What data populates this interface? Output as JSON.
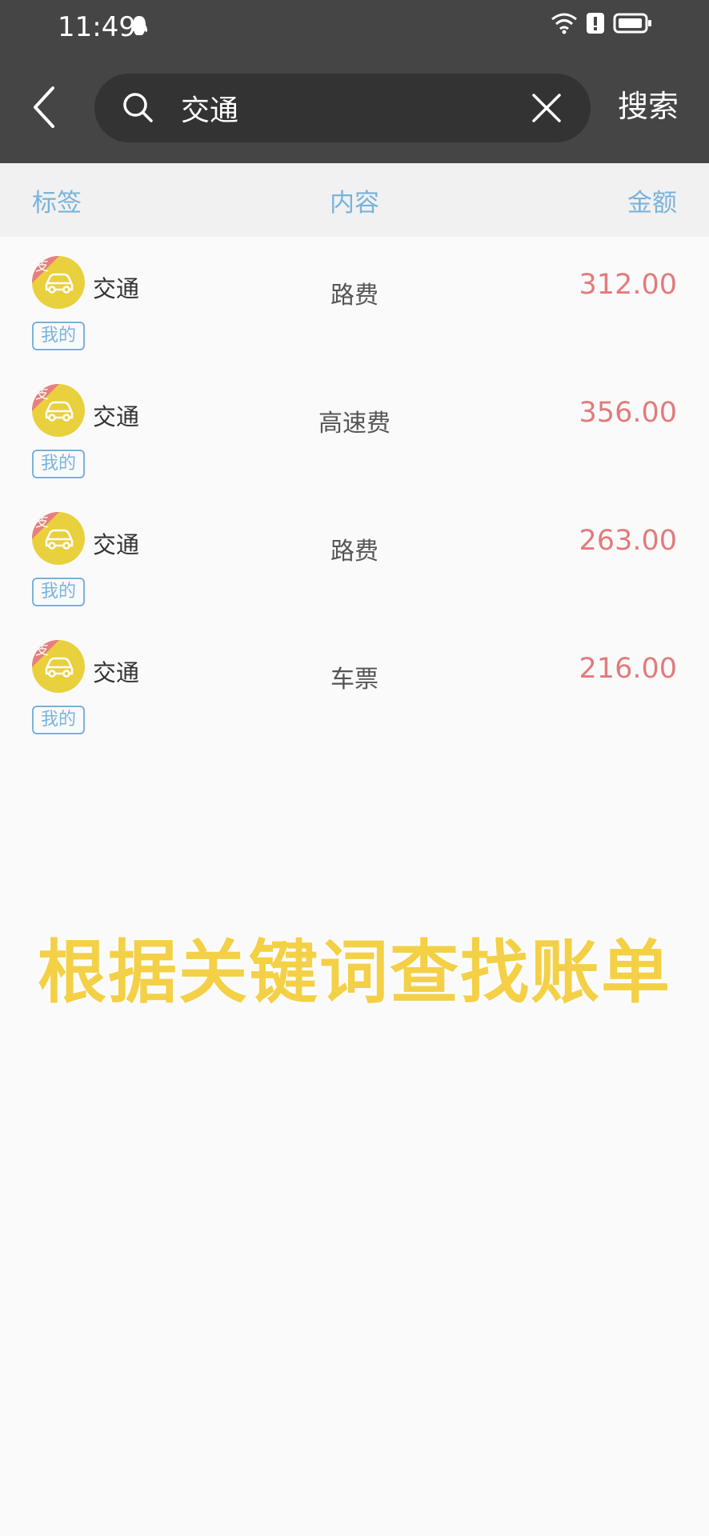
{
  "status_bar": {
    "time": "11:49"
  },
  "search": {
    "query": "交通",
    "button_label": "搜索"
  },
  "columns": {
    "tag": "标签",
    "content": "内容",
    "amount": "金额"
  },
  "records": [
    {
      "badge": "支",
      "category": "交通",
      "owner": "我的",
      "description": "路费",
      "amount": "312.00"
    },
    {
      "badge": "支",
      "category": "交通",
      "owner": "我的",
      "description": "高速费",
      "amount": "356.00"
    },
    {
      "badge": "支",
      "category": "交通",
      "owner": "我的",
      "description": "路费",
      "amount": "263.00"
    },
    {
      "badge": "支",
      "category": "交通",
      "owner": "我的",
      "description": "车票",
      "amount": "216.00"
    }
  ],
  "overlay_caption": "根据关键词查找账单",
  "colors": {
    "accent_blue": "#79b3dc",
    "expense_red": "#e37b7b",
    "category_yellow": "#e9d03d",
    "caption_yellow": "#f4d046"
  }
}
